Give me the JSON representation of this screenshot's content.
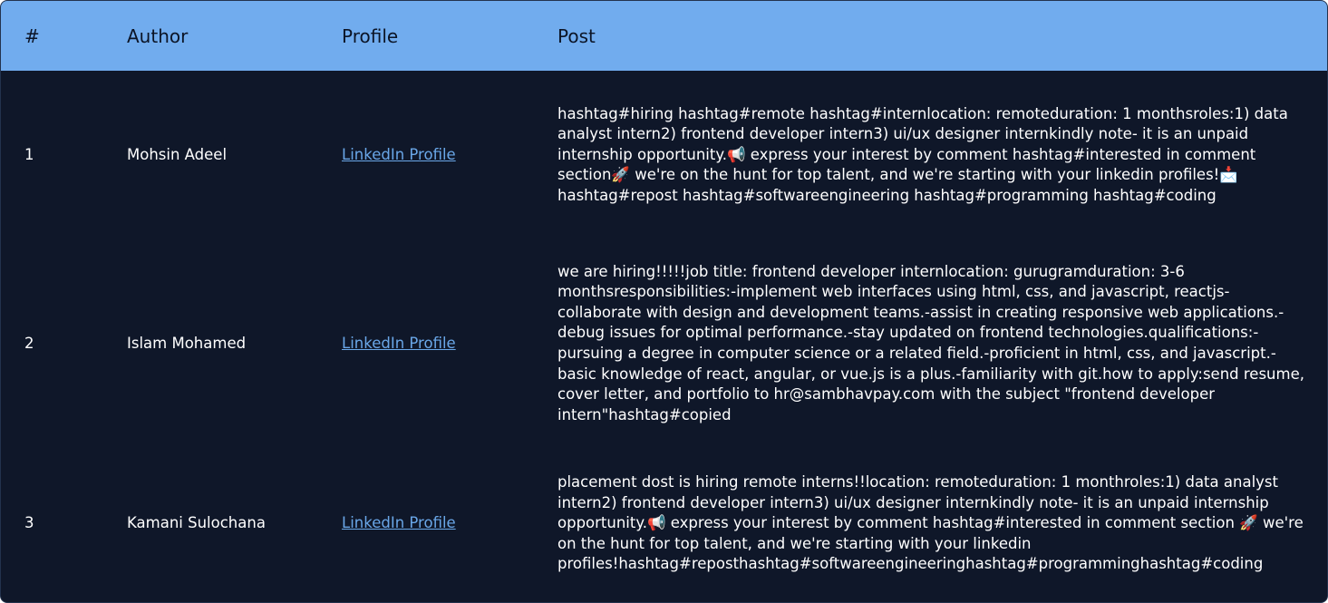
{
  "table": {
    "headers": {
      "num": "#",
      "author": "Author",
      "profile": "Profile",
      "post": "Post"
    },
    "rows": [
      {
        "num": "1",
        "author": "Mohsin Adeel",
        "profile_label": "LinkedIn Profile",
        "post": "hashtag#hiring hashtag#remote hashtag#internlocation: remoteduration: 1 monthsroles:1) data analyst intern2) frontend developer intern3) ui/ux designer internkindly note- it is an unpaid internship opportunity.📢 express your interest by comment hashtag#interested in comment section🚀 we're on the hunt for top talent, and we're starting with your linkedin profiles!📩hashtag#repost hashtag#softwareengineering hashtag#programming hashtag#coding"
      },
      {
        "num": "2",
        "author": "Islam Mohamed",
        "profile_label": "LinkedIn Profile",
        "post": "we are hiring!!!!!job title: frontend developer internlocation: gurugramduration: 3-6 monthsresponsibilities:-implement web interfaces using html, css, and javascript, reactjs-collaborate with design and development teams.-assist in creating responsive web applications.-debug issues for optimal performance.-stay updated on frontend technologies.qualifications:-pursuing a degree in computer science or a related field.-proficient in html, css, and javascript.-basic knowledge of react, angular, or vue.js is a plus.-familiarity with git.how to apply:send resume, cover letter, and portfolio to hr@sambhavpay.com with the subject \"frontend developer intern\"hashtag#copied"
      },
      {
        "num": "3",
        "author": "Kamani Sulochana",
        "profile_label": "LinkedIn Profile",
        "post": "placement dost is hiring remote interns!!location: remoteduration: 1 monthroles:1) data analyst intern2) frontend developer intern3) ui/ux designer internkindly note- it is an unpaid internship opportunity.📢 express your interest by comment hashtag#interested in comment section 🚀 we're on the hunt for top talent, and we're starting with your linkedin profiles!hashtag#reposthashtag#softwareengineeringhashtag#programminghashtag#coding"
      }
    ]
  },
  "colors": {
    "header_bg": "#71acee",
    "body_bg": "#0f1729",
    "link": "#6aa7e8",
    "text": "#ffffff"
  }
}
